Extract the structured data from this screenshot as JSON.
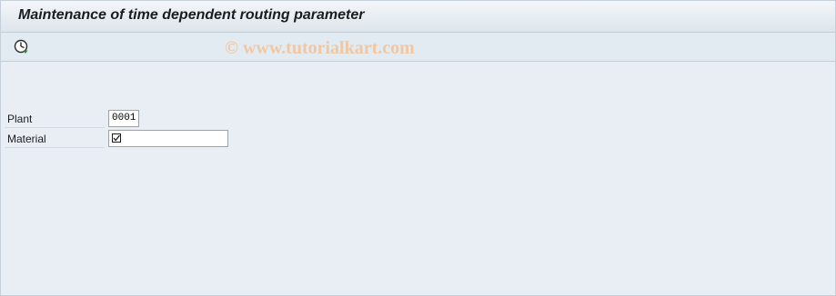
{
  "window": {
    "title": "Maintenance of time dependent routing parameter"
  },
  "toolbar": {
    "execute_icon": "execute-clock-icon",
    "watermark": "© www.tutorialkart.com"
  },
  "form": {
    "plant": {
      "label": "Plant",
      "value": "0001"
    },
    "material": {
      "label": "Material",
      "value": "",
      "required_icon": "required-checkbox-icon"
    }
  }
}
